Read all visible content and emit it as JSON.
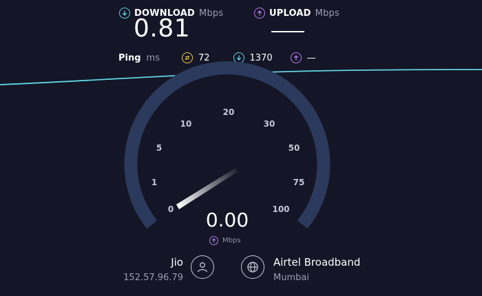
{
  "download": {
    "label": "DOWNLOAD",
    "unit": "Mbps",
    "value": "0.81",
    "icon": "download-arrow-icon",
    "color": "#5fd6e8"
  },
  "upload": {
    "label": "UPLOAD",
    "unit": "Mbps",
    "icon": "upload-arrow-icon",
    "color": "#b57bf0"
  },
  "ping": {
    "label": "Ping",
    "unit": "ms",
    "idle": "72",
    "download": "1370",
    "upload": "—",
    "idle_color": "#f2d04f",
    "download_color": "#5fd6e8",
    "upload_color": "#b57bf0"
  },
  "gauge": {
    "ticks": [
      "0",
      "1",
      "5",
      "10",
      "20",
      "30",
      "50",
      "75",
      "100"
    ],
    "current_value": "0.00",
    "unit": "Mbps",
    "arc_color": "#2b3a5c"
  },
  "provider": {
    "name": "Jio",
    "ip": "152.57.96.79"
  },
  "server": {
    "name": "Airtel Broadband",
    "location": "Mumbai"
  }
}
